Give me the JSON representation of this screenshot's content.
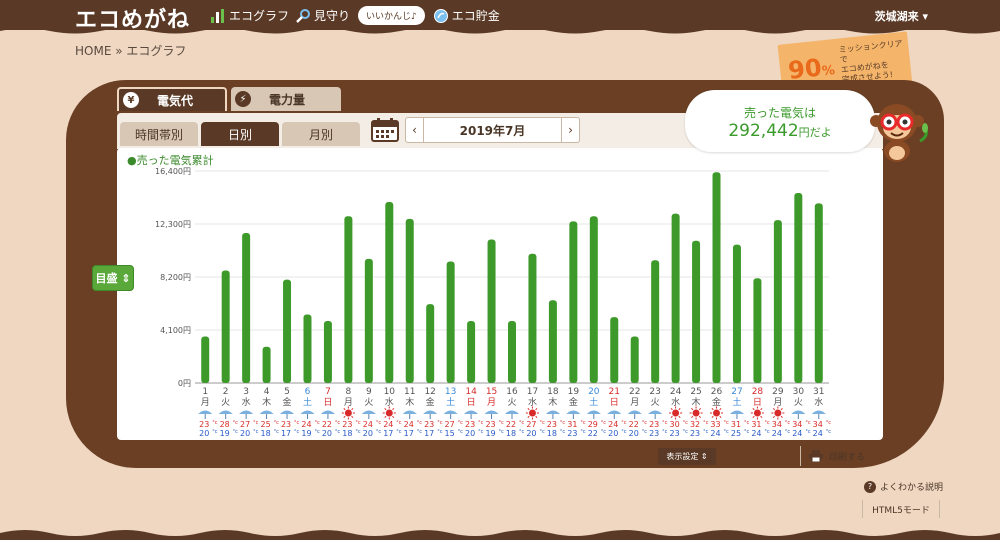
{
  "app": {
    "logo": "エコめがね"
  },
  "nav": {
    "items": [
      {
        "label": "エコグラフ"
      },
      {
        "label": "見守り"
      },
      {
        "label": "エコ貯金"
      }
    ],
    "bubble": "いいかんじ♪"
  },
  "user": {
    "name": "茨城湖来 ▾"
  },
  "breadcrumb": "HOME » エコグラフ",
  "badge": {
    "percent": "90",
    "percent_unit": "%",
    "line1": "ミッションクリアで",
    "line2": "エコめがねを",
    "line3": "完成させよう!"
  },
  "tabs": {
    "electricity_cost": "電気代",
    "power_amount": "電力量"
  },
  "subtabs": {
    "hourly": "時間帯別",
    "daily": "日別",
    "monthly": "月別"
  },
  "date": {
    "current": "2019年7月",
    "prev": "‹",
    "next": "›"
  },
  "summary": {
    "label": "売った電気は",
    "value": "292,442",
    "unit": "円だよ"
  },
  "legend": "●売った電気累計",
  "meyasu": "目盛 ⇕",
  "display_setting": "表示設定 ⇕",
  "print": "印刷する",
  "help": "よくわかる説明",
  "html5": "HTML5モード",
  "colors": {
    "bar": "#3d9a2a",
    "saturday": "#3a8ad8",
    "sunday": "#d82a2a",
    "weekday": "#555555",
    "high_temp": "#d82a2a",
    "low_temp": "#2a5ac8"
  },
  "chart_data": {
    "type": "bar",
    "yticks": [
      "0円",
      "4,100円",
      "8,200円",
      "12,300円",
      "16,400円"
    ],
    "ylim": [
      0,
      16400
    ],
    "x": [
      "1",
      "2",
      "3",
      "4",
      "5",
      "6",
      "7",
      "8",
      "9",
      "10",
      "11",
      "12",
      "13",
      "14",
      "15",
      "16",
      "17",
      "18",
      "19",
      "20",
      "21",
      "22",
      "23",
      "24",
      "25",
      "26",
      "27",
      "28",
      "29",
      "30",
      "31"
    ],
    "weekdays": [
      "月",
      "火",
      "水",
      "木",
      "金",
      "土",
      "日",
      "月",
      "火",
      "水",
      "木",
      "金",
      "土",
      "日",
      "月",
      "火",
      "水",
      "木",
      "金",
      "土",
      "日",
      "月",
      "火",
      "水",
      "木",
      "金",
      "土",
      "日",
      "月",
      "火",
      "水"
    ],
    "day_type": [
      "w",
      "w",
      "w",
      "w",
      "w",
      "sat",
      "sun",
      "w",
      "w",
      "w",
      "w",
      "w",
      "sat",
      "sun",
      "sun",
      "w",
      "w",
      "w",
      "w",
      "sat",
      "sun",
      "w",
      "w",
      "w",
      "w",
      "w",
      "sat",
      "sun",
      "w",
      "w",
      "w"
    ],
    "weather": [
      "rain",
      "rain",
      "rain",
      "rain",
      "rain",
      "rain",
      "rain",
      "sun",
      "rain",
      "sun",
      "rain",
      "rain",
      "rain",
      "rain",
      "rain",
      "rain",
      "sun",
      "rain",
      "rain",
      "rain",
      "rain",
      "rain",
      "rain",
      "sun",
      "sun",
      "sun",
      "rain",
      "sun",
      "sun",
      "rain",
      "rain"
    ],
    "values": [
      3600,
      8700,
      11600,
      2800,
      8000,
      5300,
      4800,
      12900,
      9600,
      14000,
      12700,
      6100,
      9400,
      4800,
      11100,
      4800,
      10000,
      6400,
      12500,
      12900,
      5100,
      3600,
      9500,
      13100,
      11000,
      16300,
      10700,
      8100,
      12600,
      14700,
      13900
    ],
    "high": [
      "23",
      "28",
      "27",
      "25",
      "23",
      "24",
      "22",
      "23",
      "24",
      "24",
      "24",
      "23",
      "27",
      "23",
      "23",
      "22",
      "27",
      "23",
      "31",
      "29",
      "24",
      "22",
      "23",
      "30",
      "32",
      "33",
      "31",
      "31",
      "34",
      "34",
      "34"
    ],
    "low": [
      "20",
      "19",
      "20",
      "18",
      "17",
      "19",
      "20",
      "18",
      "20",
      "17",
      "17",
      "17",
      "15",
      "20",
      "19",
      "18",
      "20",
      "18",
      "23",
      "22",
      "20",
      "20",
      "23",
      "23",
      "23",
      "24",
      "25",
      "24",
      "24",
      "24",
      "24"
    ]
  }
}
